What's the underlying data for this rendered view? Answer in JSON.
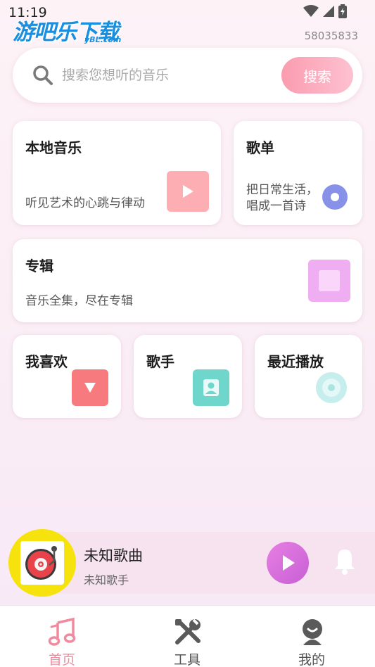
{
  "status": {
    "time": "11:19",
    "device_id": "58035833"
  },
  "watermark": {
    "logo_text": "游吧乐下载",
    "logo_sub": "yBL.com"
  },
  "search": {
    "placeholder": "搜索您想听的音乐",
    "button_label": "搜索",
    "icon": "search-icon"
  },
  "cards": {
    "local_music": {
      "title": "本地音乐",
      "subtitle": "听见艺术的心跳与律动",
      "icon": "play-icon",
      "color": "#fdaeb2"
    },
    "playlist": {
      "title": "歌单",
      "subtitle_line1": "把日常生活，",
      "subtitle_line2": "唱成一首诗",
      "icon": "record-icon",
      "color": "#8891e8"
    },
    "album": {
      "title": "专辑",
      "subtitle": "音乐全集，尽在专辑",
      "icon": "square-icon",
      "color": "#f0aef2"
    },
    "favorites": {
      "title": "我喜欢",
      "icon": "triangle-down-icon",
      "color": "#f77a7e"
    },
    "singer": {
      "title": "歌手",
      "icon": "person-icon",
      "color": "#6fd6cc"
    },
    "recent": {
      "title": "最近播放",
      "icon": "disc-icon",
      "color": "#c5eeec"
    }
  },
  "player": {
    "song_title": "未知歌曲",
    "artist": "未知歌手",
    "play_color": "#d66ddc"
  },
  "nav": {
    "items": [
      {
        "label": "首页",
        "icon": "music-note-icon",
        "active": true
      },
      {
        "label": "工具",
        "icon": "tools-icon",
        "active": false
      },
      {
        "label": "我的",
        "icon": "profile-icon",
        "active": false
      }
    ],
    "active_color": "#f08a9e"
  }
}
